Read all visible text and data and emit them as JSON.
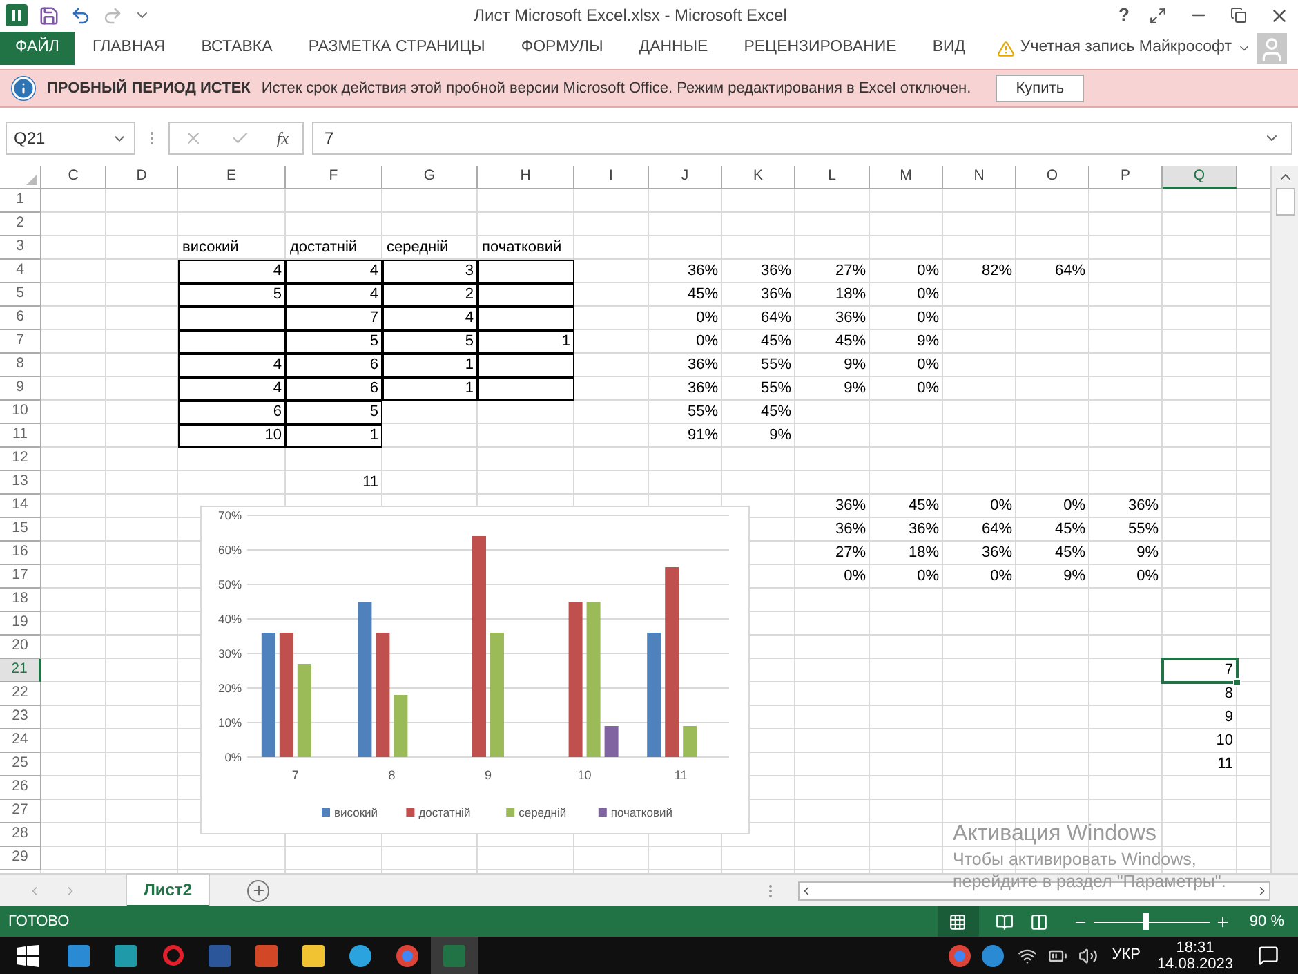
{
  "window": {
    "title": "Лист Microsoft Excel.xlsx - Microsoft Excel",
    "help": "?"
  },
  "ribbon": {
    "file_button": "ФАЙЛ",
    "tabs": [
      {
        "label": "ГЛАВНАЯ",
        "selected": false
      },
      {
        "label": "ВСТАВКА",
        "selected": false
      },
      {
        "label": "РАЗМЕТКА СТРАНИЦЫ",
        "selected": false
      },
      {
        "label": "ФОРМУЛЫ",
        "selected": false
      },
      {
        "label": "ДАННЫЕ",
        "selected": false
      },
      {
        "label": "РЕЦЕНЗИРОВАНИЕ",
        "selected": false
      },
      {
        "label": "ВИД",
        "selected": false
      }
    ],
    "account": "Учетная запись Майкрософт"
  },
  "message_bar": {
    "title": "ПРОБНЫЙ ПЕРИОД ИСТЕК",
    "text": "Истек срок действия этой пробной версии Microsoft Office. Режим редактирования в Excel отключен.",
    "button": "Купить"
  },
  "formula_bar": {
    "name_box": "Q21",
    "function_label": "fx",
    "value": "7"
  },
  "columns": [
    {
      "label": "C",
      "selected": false
    },
    {
      "label": "D",
      "selected": false
    },
    {
      "label": "E",
      "selected": false
    },
    {
      "label": "F",
      "selected": false
    },
    {
      "label": "G",
      "selected": false
    },
    {
      "label": "H",
      "selected": false
    },
    {
      "label": "I",
      "selected": false
    },
    {
      "label": "J",
      "selected": false
    },
    {
      "label": "K",
      "selected": false
    },
    {
      "label": "L",
      "selected": false
    },
    {
      "label": "M",
      "selected": false
    },
    {
      "label": "N",
      "selected": false
    },
    {
      "label": "O",
      "selected": false
    },
    {
      "label": "P",
      "selected": false
    },
    {
      "label": "Q",
      "selected": true
    }
  ],
  "rows": [
    {
      "number": "1",
      "selected": false
    },
    {
      "number": "2",
      "selected": false
    },
    {
      "number": "3",
      "selected": false,
      "cells": [
        {},
        {},
        {
          "kind": "text",
          "value": "високий"
        },
        {
          "kind": "text",
          "value": "достатній"
        },
        {
          "kind": "text",
          "value": "середній"
        },
        {
          "kind": "text",
          "value": "початковий"
        }
      ]
    },
    {
      "number": "4",
      "selected": false,
      "cells": [
        {},
        {},
        {
          "kind": "number",
          "value": "4",
          "bordered": true
        },
        {
          "kind": "number",
          "value": "4",
          "bordered": true
        },
        {
          "kind": "number",
          "value": "3",
          "bordered": true
        },
        {
          "bordered": true
        },
        {},
        {
          "kind": "number",
          "value": "36%"
        },
        {
          "kind": "number",
          "value": "36%"
        },
        {
          "kind": "number",
          "value": "27%"
        },
        {
          "kind": "number",
          "value": "0%"
        },
        {
          "kind": "number",
          "value": "82%"
        },
        {
          "kind": "number",
          "value": "64%"
        }
      ]
    },
    {
      "number": "5",
      "selected": false,
      "cells": [
        {},
        {},
        {
          "kind": "number",
          "value": "5",
          "bordered": true
        },
        {
          "kind": "number",
          "value": "4",
          "bordered": true
        },
        {
          "kind": "number",
          "value": "2",
          "bordered": true
        },
        {
          "bordered": true
        },
        {},
        {
          "kind": "number",
          "value": "45%"
        },
        {
          "kind": "number",
          "value": "36%"
        },
        {
          "kind": "number",
          "value": "18%"
        },
        {
          "kind": "number",
          "value": "0%"
        }
      ]
    },
    {
      "number": "6",
      "selected": false,
      "cells": [
        {},
        {},
        {
          "bordered": true
        },
        {
          "kind": "number",
          "value": "7",
          "bordered": true
        },
        {
          "kind": "number",
          "value": "4",
          "bordered": true
        },
        {
          "bordered": true
        },
        {},
        {
          "kind": "number",
          "value": "0%"
        },
        {
          "kind": "number",
          "value": "64%"
        },
        {
          "kind": "number",
          "value": "36%"
        },
        {
          "kind": "number",
          "value": "0%"
        }
      ]
    },
    {
      "number": "7",
      "selected": false,
      "cells": [
        {},
        {},
        {
          "bordered": true
        },
        {
          "kind": "number",
          "value": "5",
          "bordered": true
        },
        {
          "kind": "number",
          "value": "5",
          "bordered": true
        },
        {
          "kind": "number",
          "value": "1",
          "bordered": true
        },
        {},
        {
          "kind": "number",
          "value": "0%"
        },
        {
          "kind": "number",
          "value": "45%"
        },
        {
          "kind": "number",
          "value": "45%"
        },
        {
          "kind": "number",
          "value": "9%"
        }
      ]
    },
    {
      "number": "8",
      "selected": false,
      "cells": [
        {},
        {},
        {
          "kind": "number",
          "value": "4",
          "bordered": true
        },
        {
          "kind": "number",
          "value": "6",
          "bordered": true
        },
        {
          "kind": "number",
          "value": "1",
          "bordered": true
        },
        {
          "bordered": true
        },
        {},
        {
          "kind": "number",
          "value": "36%"
        },
        {
          "kind": "number",
          "value": "55%"
        },
        {
          "kind": "number",
          "value": "9%"
        },
        {
          "kind": "number",
          "value": "0%"
        }
      ]
    },
    {
      "number": "9",
      "selected": false,
      "cells": [
        {},
        {},
        {
          "kind": "number",
          "value": "4",
          "bordered": true
        },
        {
          "kind": "number",
          "value": "6",
          "bordered": true
        },
        {
          "kind": "number",
          "value": "1",
          "bordered": true
        },
        {
          "bordered": true
        },
        {},
        {
          "kind": "number",
          "value": "36%"
        },
        {
          "kind": "number",
          "value": "55%"
        },
        {
          "kind": "number",
          "value": "9%"
        },
        {
          "kind": "number",
          "value": "0%"
        }
      ]
    },
    {
      "number": "10",
      "selected": false,
      "cells": [
        {},
        {},
        {
          "kind": "number",
          "value": "6",
          "bordered": true
        },
        {
          "kind": "number",
          "value": "5",
          "bordered": true
        },
        {},
        {},
        {},
        {
          "kind": "number",
          "value": "55%"
        },
        {
          "kind": "number",
          "value": "45%"
        }
      ]
    },
    {
      "number": "11",
      "selected": false,
      "cells": [
        {},
        {},
        {
          "kind": "number",
          "value": "10",
          "bordered": true
        },
        {
          "kind": "number",
          "value": "1",
          "bordered": true
        },
        {},
        {},
        {},
        {
          "kind": "number",
          "value": "91%"
        },
        {
          "kind": "number",
          "value": "9%"
        }
      ]
    },
    {
      "number": "12",
      "selected": false
    },
    {
      "number": "13",
      "selected": false,
      "cells": [
        {},
        {},
        {},
        {
          "kind": "number",
          "value": "11"
        }
      ]
    },
    {
      "number": "14",
      "selected": false,
      "cells": [
        {},
        {},
        {},
        {},
        {},
        {},
        {},
        {},
        {},
        {
          "kind": "number",
          "value": "36%"
        },
        {
          "kind": "number",
          "value": "45%"
        },
        {
          "kind": "number",
          "value": "0%"
        },
        {
          "kind": "number",
          "value": "0%"
        },
        {
          "kind": "number",
          "value": "36%"
        }
      ]
    },
    {
      "number": "15",
      "selected": false,
      "cells": [
        {},
        {},
        {},
        {},
        {},
        {},
        {},
        {},
        {},
        {
          "kind": "number",
          "value": "36%"
        },
        {
          "kind": "number",
          "value": "36%"
        },
        {
          "kind": "number",
          "value": "64%"
        },
        {
          "kind": "number",
          "value": "45%"
        },
        {
          "kind": "number",
          "value": "55%"
        }
      ]
    },
    {
      "number": "16",
      "selected": false,
      "cells": [
        {},
        {},
        {},
        {},
        {},
        {},
        {},
        {},
        {},
        {
          "kind": "number",
          "value": "27%"
        },
        {
          "kind": "number",
          "value": "18%"
        },
        {
          "kind": "number",
          "value": "36%"
        },
        {
          "kind": "number",
          "value": "45%"
        },
        {
          "kind": "number",
          "value": "9%"
        }
      ]
    },
    {
      "number": "17",
      "selected": false,
      "cells": [
        {},
        {},
        {},
        {},
        {},
        {},
        {},
        {},
        {},
        {
          "kind": "number",
          "value": "0%"
        },
        {
          "kind": "number",
          "value": "0%"
        },
        {
          "kind": "number",
          "value": "0%"
        },
        {
          "kind": "number",
          "value": "9%"
        },
        {
          "kind": "number",
          "value": "0%"
        }
      ]
    },
    {
      "number": "18",
      "selected": false
    },
    {
      "number": "19",
      "selected": false
    },
    {
      "number": "20",
      "selected": false
    },
    {
      "number": "21",
      "selected": true,
      "cells": [
        {},
        {},
        {},
        {},
        {},
        {},
        {},
        {},
        {},
        {},
        {},
        {},
        {},
        {},
        {
          "kind": "number",
          "value": "7",
          "selected": true
        }
      ]
    },
    {
      "number": "22",
      "selected": false,
      "cells": [
        {},
        {},
        {},
        {},
        {},
        {},
        {},
        {},
        {},
        {},
        {},
        {},
        {},
        {},
        {
          "kind": "number",
          "value": "8"
        }
      ]
    },
    {
      "number": "23",
      "selected": false,
      "cells": [
        {},
        {},
        {},
        {},
        {},
        {},
        {},
        {},
        {},
        {},
        {},
        {},
        {},
        {},
        {
          "kind": "number",
          "value": "9"
        }
      ]
    },
    {
      "number": "24",
      "selected": false,
      "cells": [
        {},
        {},
        {},
        {},
        {},
        {},
        {},
        {},
        {},
        {},
        {},
        {},
        {},
        {},
        {
          "kind": "number",
          "value": "10"
        }
      ]
    },
    {
      "number": "25",
      "selected": false,
      "cells": [
        {},
        {},
        {},
        {},
        {},
        {},
        {},
        {},
        {},
        {},
        {},
        {},
        {},
        {},
        {
          "kind": "number",
          "value": "11"
        }
      ]
    },
    {
      "number": "26",
      "selected": false
    },
    {
      "number": "27",
      "selected": false
    },
    {
      "number": "28",
      "selected": false
    },
    {
      "number": "29",
      "selected": false
    }
  ],
  "chart": {
    "chart_data": {
      "type": "bar",
      "grid": true,
      "legend": true,
      "categories": [
        "7",
        "8",
        "9",
        "10",
        "11"
      ],
      "ylim": [
        0,
        70
      ],
      "yticks": [
        {
          "value": 0,
          "label": "0%"
        },
        {
          "value": 10,
          "label": "10%"
        },
        {
          "value": 20,
          "label": "20%"
        },
        {
          "value": 30,
          "label": "30%"
        },
        {
          "value": 40,
          "label": "40%"
        },
        {
          "value": 50,
          "label": "50%"
        },
        {
          "value": 60,
          "label": "60%"
        },
        {
          "value": 70,
          "label": "70%"
        }
      ],
      "series": [
        {
          "name": "високий",
          "color": "#4f81bd",
          "values": [
            36,
            45,
            0,
            0,
            36
          ]
        },
        {
          "name": "достатній",
          "color": "#c0504d",
          "values": [
            36,
            36,
            64,
            45,
            55
          ]
        },
        {
          "name": "середній",
          "color": "#9bbb59",
          "values": [
            27,
            18,
            36,
            45,
            9
          ]
        },
        {
          "name": "початковий",
          "color": "#8064a2",
          "values": [
            0,
            0,
            0,
            9,
            0
          ]
        }
      ]
    }
  },
  "sheet_tabs": [
    {
      "label": "Лист2",
      "selected": true
    }
  ],
  "status_bar": {
    "status": "ГОТОВО",
    "zoom": "90 %",
    "level": 0.45
  },
  "activation": {
    "title": "Активация Windows",
    "lines": [
      "Чтобы активировать Windows,",
      "перейдите в раздел \"Параметры\"."
    ]
  },
  "taskbar": {
    "language": "УКР",
    "time": "18:31",
    "date": "14.08.2023"
  }
}
